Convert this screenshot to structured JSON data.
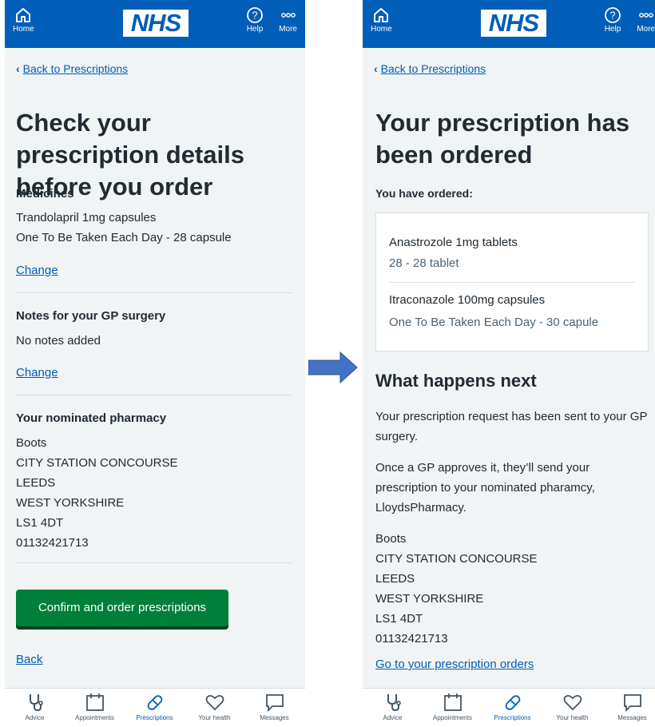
{
  "header": {
    "home_label": "Home",
    "logo_text": "NHS",
    "help_label": "Help",
    "more_label": "More"
  },
  "bottom_nav": {
    "items": [
      {
        "label": "Advice",
        "icon": "stethoscope-icon"
      },
      {
        "label": "Appointments",
        "icon": "calendar-icon"
      },
      {
        "label": "Prescriptions",
        "icon": "pill-icon",
        "active": true
      },
      {
        "label": "Your health",
        "icon": "heart-icon"
      },
      {
        "label": "Messages",
        "icon": "message-icon"
      }
    ]
  },
  "left": {
    "back_link": "Back to Prescriptions",
    "title": "Check your prescription details before you order",
    "medicines_heading": "Medicines",
    "medicine_name": "Trandolapril 1mg capsules",
    "medicine_dosage": "One To Be Taken Each Day - 28 capsule",
    "change_link_1": "Change",
    "notes_heading": "Notes for your GP surgery",
    "notes_value": "No notes added",
    "change_link_2": "Change",
    "pharmacy_heading": "Your nominated pharmacy",
    "pharmacy_address": [
      "Boots",
      "CITY STATION CONCOURSE",
      "LEEDS",
      "WEST YORKSHIRE",
      "LS1 4DT",
      "01132421713"
    ],
    "confirm_button": "Confirm and order prescriptions",
    "back_bottom": "Back"
  },
  "right": {
    "back_link": "Back to Prescriptions",
    "title": "Your prescription has been ordered",
    "ordered_label": "You have ordered:",
    "ordered_items": [
      {
        "name": "Anastrozole 1mg tablets",
        "detail": "28 - 28 tablet"
      },
      {
        "name": "Itraconazole 100mg capsules",
        "detail": "One To Be Taken Each Day - 30 capule"
      }
    ],
    "next_heading": "What happens next",
    "para1": "Your prescription request has been sent to your GP surgery.",
    "para2": "Once a GP approves it, they’ll send your prescription to your nominated pharamcy, LloydsPharmacy.",
    "pharmacy_address": [
      "Boots",
      "CITY STATION CONCOURSE",
      "LEEDS",
      "WEST YORKSHIRE",
      "LS1 4DT",
      "01132421713"
    ],
    "orders_link": "Go to your prescription orders"
  },
  "colors": {
    "nhs_blue": "#005eb8",
    "green_button": "#007f3b",
    "page_bg": "#f0f4f5",
    "arrow": "#4472c4"
  }
}
